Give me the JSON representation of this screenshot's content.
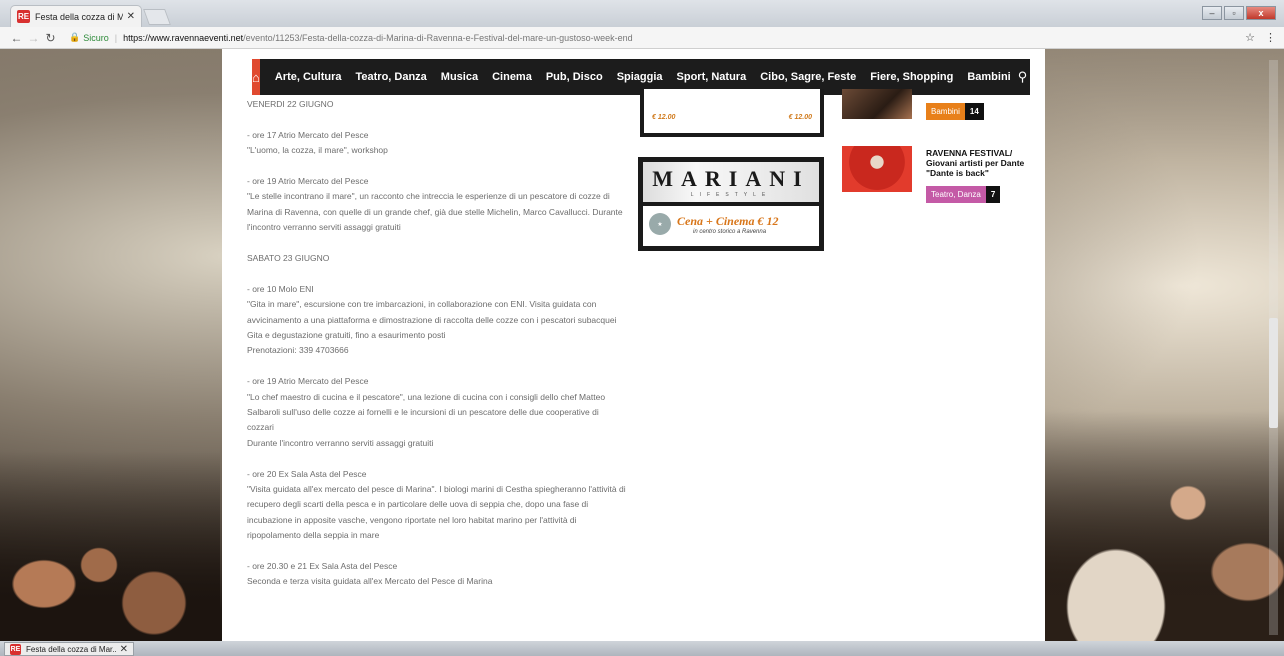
{
  "browser": {
    "tab_title": "Festa della cozza di Mar...",
    "favicon_label": "RE",
    "tab_close": "✕",
    "window_controls": [
      "–",
      "▫",
      "x"
    ],
    "secure_label": "Sicuro",
    "url_host": "https://www.ravennaeventi.net",
    "url_path": "/evento/11253/Festa-della-cozza-di-Marina-di-Ravenna-e-Festival-del-mare-un-gustoso-week-end"
  },
  "nav": {
    "items": [
      "Arte, Cultura",
      "Teatro, Danza",
      "Musica",
      "Cinema",
      "Pub, Disco",
      "Spiaggia",
      "Sport, Natura",
      "Cibo, Sagre, Feste",
      "Fiere, Shopping",
      "Bambini"
    ],
    "accent_color": "#e0492f"
  },
  "article": {
    "paragraphs": [
      "VENERDI 22 GIUGNO",
      "- ore 17 Atrio Mercato del Pesce\n\"L'uomo, la cozza, il mare\", workshop",
      "- ore 19 Atrio Mercato del Pesce\n\"Le stelle incontrano il mare\", un racconto che intreccia le esperienze di un pescatore di cozze di Marina di Ravenna, con quelle di un grande chef, già due stelle Michelin, Marco Cavallucci. Durante l'incontro verranno serviti assaggi gratuiti",
      "SABATO 23 GIUGNO",
      "- ore 10 Molo ENI\n\"Gita in mare\", escursione con tre imbarcazioni, in collaborazione con ENI. Visita guidata con avvicinamento a una piattaforma e dimostrazione di raccolta delle cozze con i pescatori subacquei\nGita e degustazione gratuiti, fino a esaurimento posti\nPrenotazioni: 339 4703666",
      "- ore 19 Atrio Mercato del Pesce\n\"Lo chef maestro di cucina e il pescatore\", una lezione di cucina con i consigli dello chef Matteo Salbaroli sull'uso delle cozze ai fornelli e le incursioni di un pescatore delle due cooperative di cozzari\nDurante l'incontro verranno serviti assaggi gratuiti",
      "- ore 20 Ex Sala Asta del Pesce\n\"Visita guidata all'ex mercato del pesce di Marina\". I biologi marini di Cestha spiegheranno l'attività di recupero degli scarti della pesca e in particolare delle uova di seppia che, dopo una fase di incubazione in apposite vasche, vengono riportate nel loro habitat marino per l'attività di ripopolamento della seppia in mare",
      "- ore 20.30 e 21 Ex Sala Asta del Pesce\nSeconda e terza visita guidata all'ex Mercato del Pesce di Marina"
    ]
  },
  "ads": {
    "top_prices": [
      "€ 12.00",
      "€ 12.00"
    ],
    "mariani_name": "MARIANI",
    "mariani_sub": "LIFESTYLE",
    "promo_main": "Cena + Cinema  € 12",
    "promo_sub": "in centro storico a Ravenna"
  },
  "events": [
    {
      "title": "",
      "tag": "Bambini",
      "count": "14",
      "tag_color": "#e8801a"
    },
    {
      "title": "RAVENNA FESTIVAL/ Giovani artisti per Dante \"Dante is back\"",
      "tag": "Teatro, Danza",
      "count": "7",
      "tag_color": "#c45aa6"
    }
  ],
  "taskbar": {
    "tab_title": "Festa della cozza di Mar..."
  }
}
